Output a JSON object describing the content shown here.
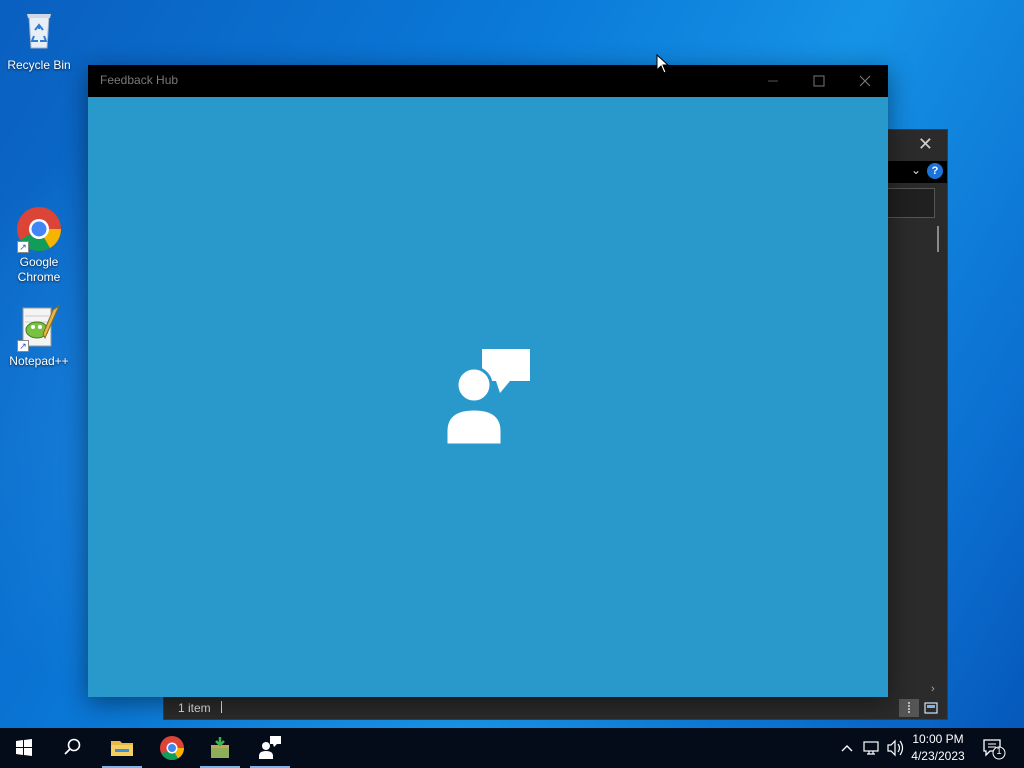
{
  "desktop": {
    "icons": [
      {
        "label": "Recycle Bin"
      },
      {
        "label": "Google Chrome"
      },
      {
        "label": "Notepad++"
      }
    ]
  },
  "feedback_hub": {
    "title": "Feedback Hub",
    "accent_color": "#2999cc",
    "splash_icon": "feedback-person-icon"
  },
  "explorer": {
    "status_text": "1 item"
  },
  "taskbar": {
    "pinned": [
      {
        "name": "start-icon"
      },
      {
        "name": "search-icon"
      },
      {
        "name": "file-explorer-icon"
      },
      {
        "name": "chrome-icon"
      },
      {
        "name": "installer-icon"
      },
      {
        "name": "feedback-hub-icon"
      }
    ],
    "clock": {
      "time": "10:00 PM",
      "date": "4/23/2023"
    },
    "notification_count": "1"
  }
}
